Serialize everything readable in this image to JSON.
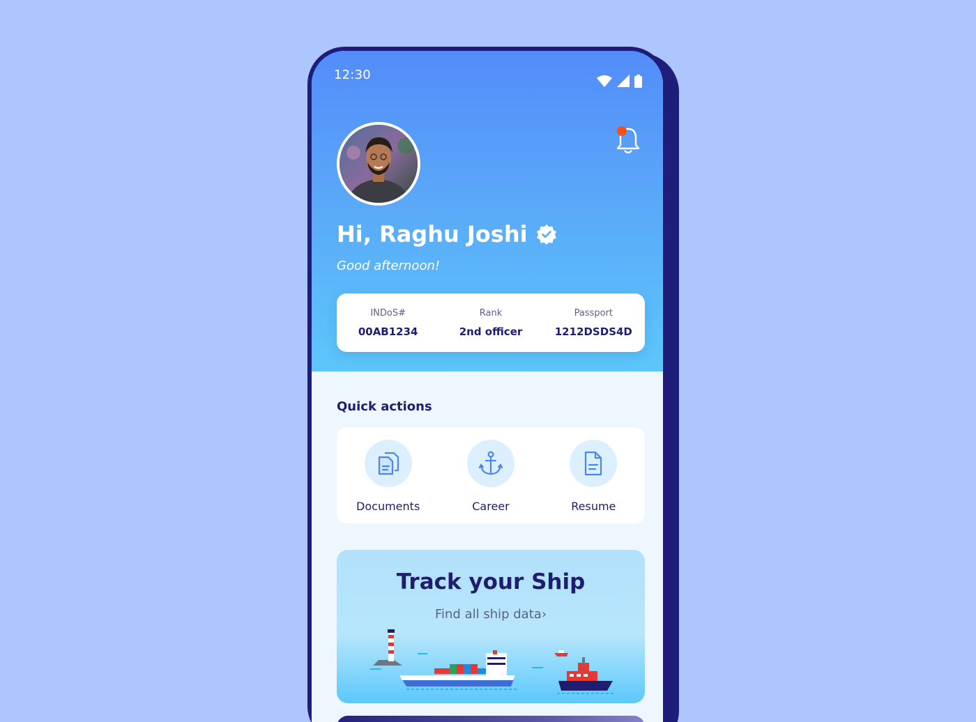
{
  "status_bar": {
    "time": "12:30"
  },
  "user": {
    "greeting": "Hi, Raghu Joshi",
    "subgreeting": "Good afternoon!"
  },
  "id_card": [
    {
      "label": "INDoS#",
      "value": "00AB1234"
    },
    {
      "label": "Rank",
      "value": "2nd officer"
    },
    {
      "label": "Passport",
      "value": "1212DSDS4D"
    }
  ],
  "quick_actions": {
    "title": "Quick actions",
    "items": [
      {
        "label": "Documents",
        "icon": "documents-icon"
      },
      {
        "label": "Career",
        "icon": "anchor-icon"
      },
      {
        "label": "Resume",
        "icon": "resume-icon"
      }
    ]
  },
  "track_ship": {
    "title": "Track your Ship",
    "link": "Find all ship data"
  },
  "colors": {
    "background": "#adc6fe",
    "header_top": "#538cf9",
    "header_bottom": "#5cc7fb",
    "navy": "#1f1d6e",
    "notification": "#f4511e"
  }
}
